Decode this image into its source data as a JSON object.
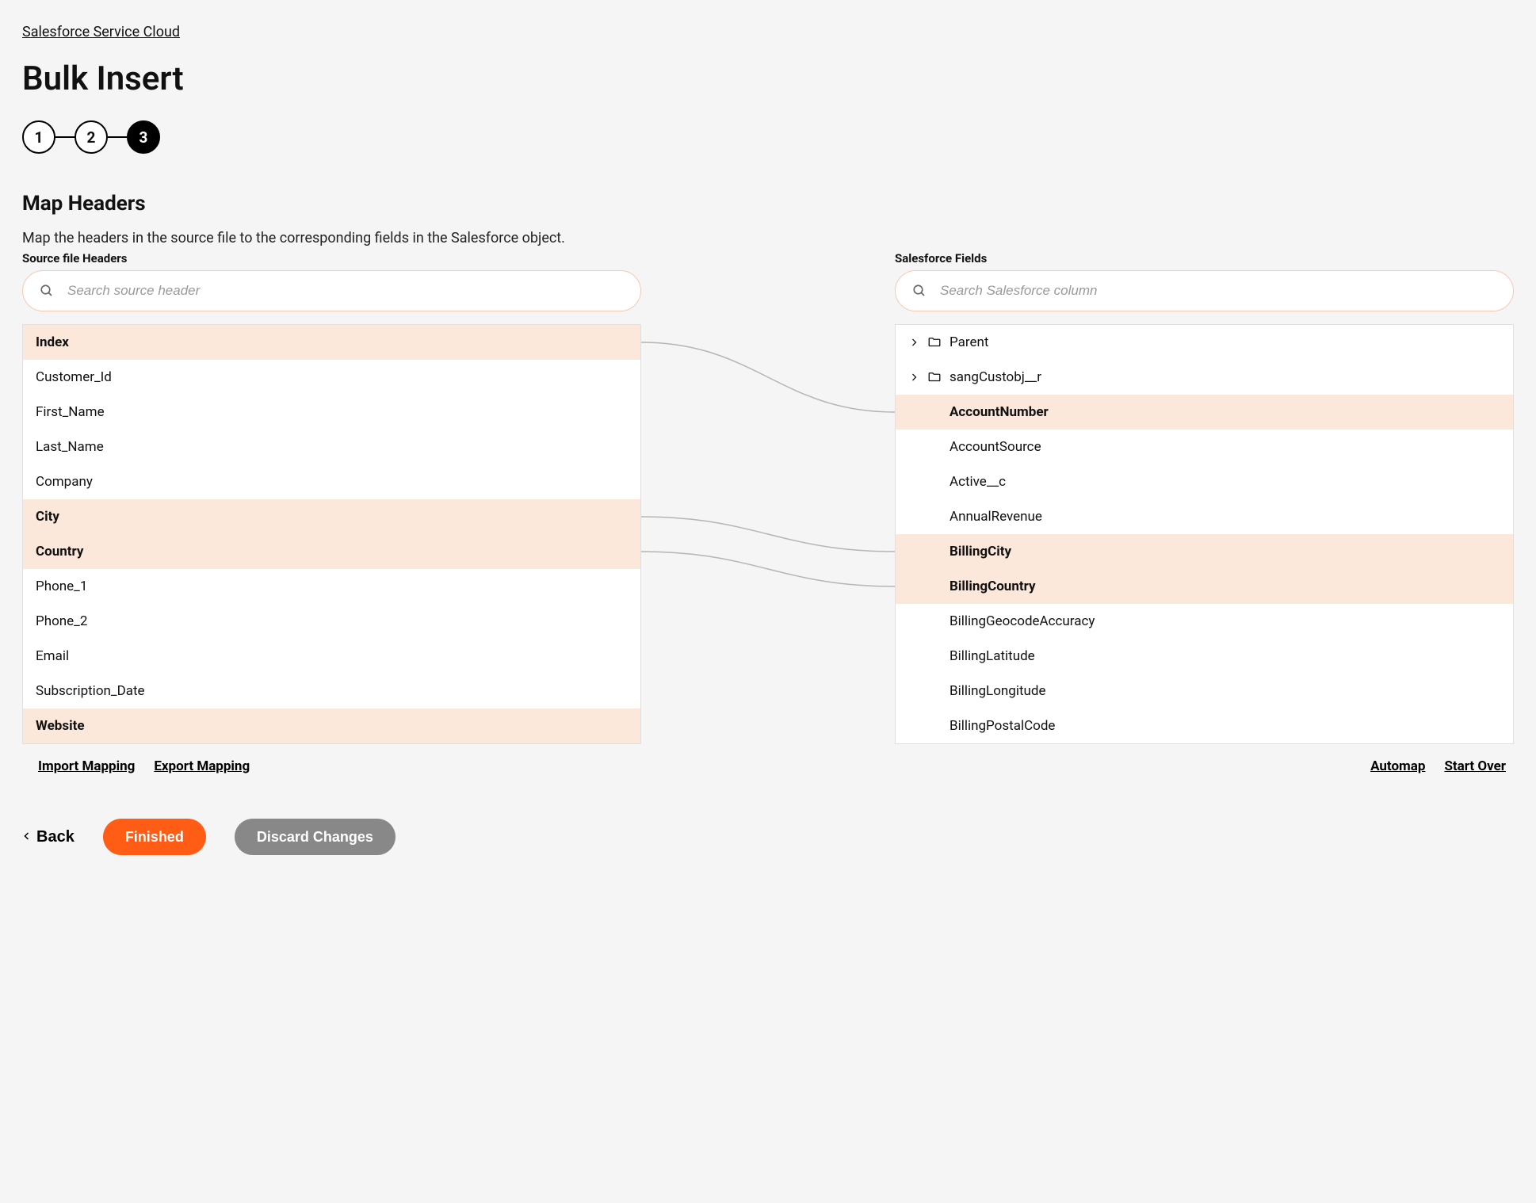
{
  "breadcrumb": "Salesforce Service Cloud",
  "page_title": "Bulk Insert",
  "stepper": {
    "steps": [
      "1",
      "2",
      "3"
    ],
    "active_index": 2
  },
  "section": {
    "title": "Map Headers",
    "description": "Map the headers in the source file to the corresponding fields in the Salesforce object."
  },
  "source": {
    "label": "Source file Headers",
    "search_placeholder": "Search source header",
    "items": [
      {
        "label": "Index",
        "mapped": true
      },
      {
        "label": "Customer_Id",
        "mapped": false
      },
      {
        "label": "First_Name",
        "mapped": false
      },
      {
        "label": "Last_Name",
        "mapped": false
      },
      {
        "label": "Company",
        "mapped": false
      },
      {
        "label": "City",
        "mapped": true
      },
      {
        "label": "Country",
        "mapped": true
      },
      {
        "label": "Phone_1",
        "mapped": false
      },
      {
        "label": "Phone_2",
        "mapped": false
      },
      {
        "label": "Email",
        "mapped": false
      },
      {
        "label": "Subscription_Date",
        "mapped": false
      },
      {
        "label": "Website",
        "mapped": true
      }
    ]
  },
  "target": {
    "label": "Salesforce Fields",
    "search_placeholder": "Search Salesforce column",
    "items": [
      {
        "label": "Parent",
        "mapped": false,
        "folder": true
      },
      {
        "label": "sangCustobj__r",
        "mapped": false,
        "folder": true
      },
      {
        "label": "AccountNumber",
        "mapped": true
      },
      {
        "label": "AccountSource",
        "mapped": false
      },
      {
        "label": "Active__c",
        "mapped": false
      },
      {
        "label": "AnnualRevenue",
        "mapped": false
      },
      {
        "label": "BillingCity",
        "mapped": true
      },
      {
        "label": "BillingCountry",
        "mapped": true
      },
      {
        "label": "BillingGeocodeAccuracy",
        "mapped": false
      },
      {
        "label": "BillingLatitude",
        "mapped": false
      },
      {
        "label": "BillingLongitude",
        "mapped": false
      },
      {
        "label": "BillingPostalCode",
        "mapped": false
      }
    ]
  },
  "mappings": [
    {
      "source": "Index",
      "target": "AccountNumber"
    },
    {
      "source": "City",
      "target": "BillingCity"
    },
    {
      "source": "Country",
      "target": "BillingCountry"
    }
  ],
  "actions": {
    "import_mapping": "Import Mapping",
    "export_mapping": "Export Mapping",
    "automap": "Automap",
    "start_over": "Start Over",
    "back": "Back",
    "finished": "Finished",
    "discard": "Discard Changes"
  }
}
